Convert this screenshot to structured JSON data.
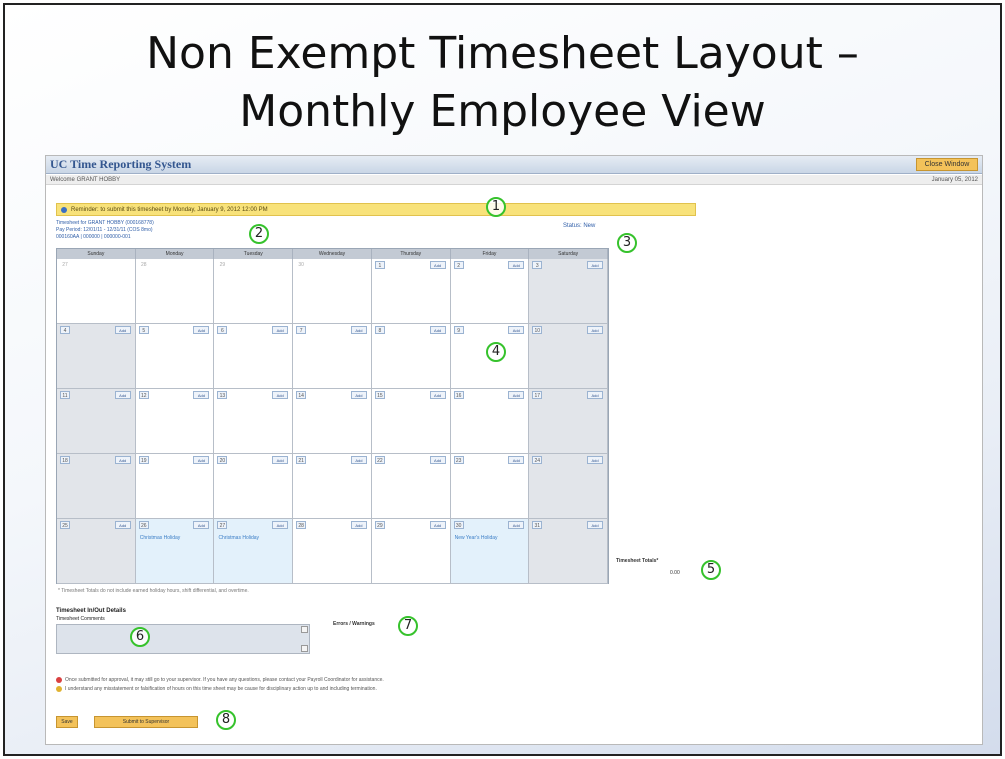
{
  "slide": {
    "title_line1": "Non Exempt Timesheet Layout –",
    "title_line2": "Monthly Employee View"
  },
  "app": {
    "title": "UC Time Reporting System",
    "close_button": "Close Window",
    "welcome": "Welcome GRANT HOBBY",
    "date": "January 05, 2012"
  },
  "reminder": {
    "text": "Reminder: to submit this timesheet by Monday, January 9, 2012 12:00 PM"
  },
  "info": {
    "line1": "Timesheet for GRANT HOBBY (000168778)",
    "line2": "Pay Period: 12/01/11 - 12/31/11 (COS 8mo)",
    "line3": "000160AA | 000000 | 000000-001",
    "status": "Status: New"
  },
  "calendar": {
    "days": [
      "Sunday",
      "Monday",
      "Tuesday",
      "Wednesday",
      "Thursday",
      "Friday",
      "Saturday"
    ],
    "add_label": "Add",
    "weeks": [
      [
        "27",
        "28",
        "29",
        "30",
        "1",
        "2",
        "3"
      ],
      [
        "4",
        "5",
        "6",
        "7",
        "8",
        "9",
        "10"
      ],
      [
        "11",
        "12",
        "13",
        "14",
        "15",
        "16",
        "17"
      ],
      [
        "18",
        "19",
        "20",
        "21",
        "22",
        "23",
        "24"
      ],
      [
        "25",
        "26",
        "27",
        "28",
        "29",
        "30",
        "31"
      ]
    ],
    "holidays": {
      "christmas": "Christmas Holiday",
      "new_year": "New Year's Holiday"
    },
    "note": "* Timesheet Totals do not include earned holiday hours, shift differential, and overtime."
  },
  "totals": {
    "label": "Timesheet Totals*",
    "value": "0.00"
  },
  "inout": {
    "title": "Timesheet In/Out Details",
    "comments_label": "Timesheet Comments"
  },
  "errors": {
    "label": "Errors / Warnings"
  },
  "warnings": {
    "line1": "Once submitted for approval, it may still go to your supervisor. If you have any questions, please contact your Payroll Coordinator for assistance.",
    "line2": "I understand any misstatement or falsification of hours on this time sheet may be cause for disciplinary action up to and including termination."
  },
  "buttons": {
    "save": "Save",
    "submit": "Submit to Supervisor"
  },
  "callouts": [
    "1",
    "2",
    "3",
    "4",
    "5",
    "6",
    "7",
    "8"
  ],
  "colors": {
    "callout": "#36c22c",
    "reminder": "#f8e27a",
    "button": "#f3c25a",
    "header_title": "#33568f"
  }
}
